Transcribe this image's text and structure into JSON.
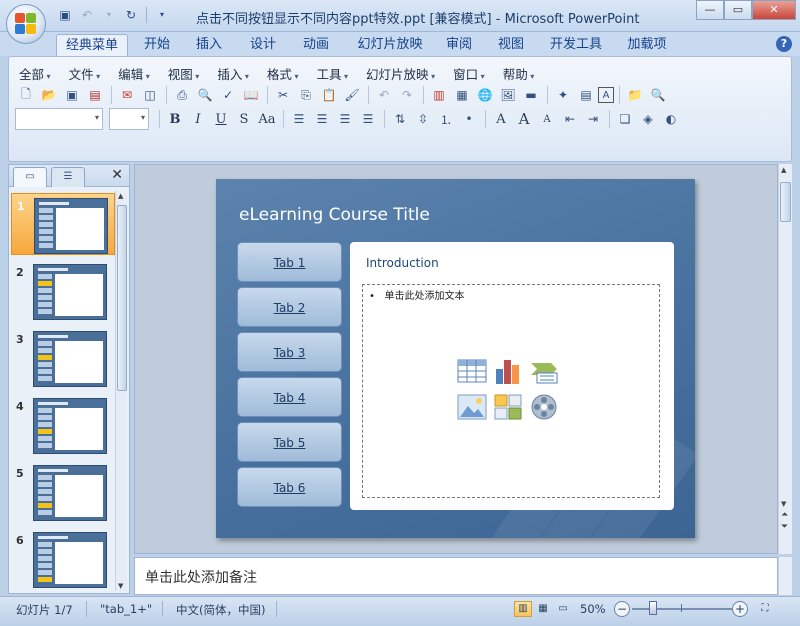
{
  "window": {
    "title": "点击不同按钮显示不同内容ppt特效.ppt [兼容模式] - Microsoft PowerPoint"
  },
  "ribbon_tabs": [
    "经典菜单",
    "开始",
    "插入",
    "设计",
    "动画",
    "幻灯片放映",
    "审阅",
    "视图",
    "开发工具",
    "加载项"
  ],
  "active_tab": "经典菜单",
  "menus": [
    "全部",
    "文件",
    "编辑",
    "视图",
    "插入",
    "格式",
    "工具",
    "幻灯片放映",
    "窗口",
    "帮助"
  ],
  "format_buttons": {
    "bold": "B",
    "italic": "I",
    "underline": "U",
    "shadow": "S",
    "case": "Aa",
    "font_grow": "A",
    "font_shrink": "A",
    "font_color": "A"
  },
  "slides_panel": {
    "slide_numbers": [
      "1",
      "2",
      "3",
      "4",
      "5",
      "6"
    ],
    "active_slide": "1"
  },
  "slide": {
    "title": "eLearning Course Title",
    "tabs": [
      "Tab 1",
      "Tab 2",
      "Tab 3",
      "Tab 4",
      "Tab 5",
      "Tab 6"
    ],
    "content_heading": "Introduction",
    "placeholder_bullet": "•",
    "placeholder_text": "单击此处添加文本"
  },
  "notes": {
    "placeholder": "单击此处添加备注"
  },
  "status": {
    "slide_info": "幻灯片 1/7",
    "theme": "\"tab_1+\"",
    "language": "中文(简体，中国)",
    "zoom": "50%"
  },
  "colors": {
    "slide_bg": "#4a72a0",
    "accent_orange": "#f7a83c",
    "tab_button": "#b3cbe4"
  }
}
